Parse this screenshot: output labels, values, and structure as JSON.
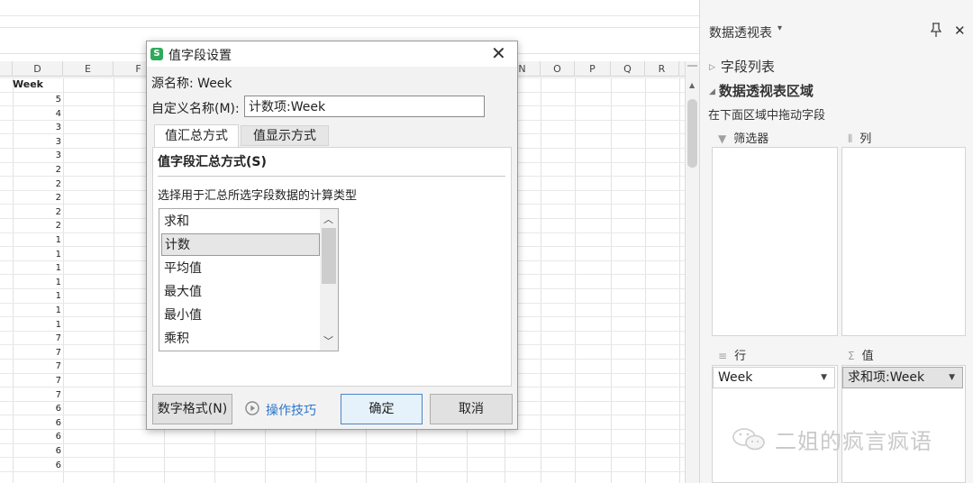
{
  "sheet": {
    "columns": [
      "D",
      "E",
      "F",
      "N",
      "O",
      "P",
      "Q",
      "R"
    ],
    "header_cell": "Week",
    "week_values": [
      "5",
      "4",
      "3",
      "3",
      "3",
      "2",
      "2",
      "2",
      "2",
      "2",
      "1",
      "1",
      "1",
      "1",
      "1",
      "1",
      "1",
      "7",
      "7",
      "7",
      "7",
      "7",
      "6",
      "6",
      "6",
      "6",
      "6"
    ]
  },
  "pane": {
    "title": "数据透视表",
    "field_list": "字段列表",
    "pivot_area": "数据透视表区域",
    "drag_hint": "在下面区域中拖动字段",
    "zones": {
      "filter": "筛选器",
      "columns": "列",
      "rows": "行",
      "values": "值"
    },
    "row_field": "Week",
    "value_field": "求和项:Week"
  },
  "watermark": "二姐的疯言疯语",
  "dialog": {
    "title": "值字段设置",
    "logo": "S",
    "source_label": "源名称:",
    "source_value": "Week",
    "custom_name_label": "自定义名称(M):",
    "custom_name_value": "计数项:Week",
    "tabs": [
      "值汇总方式",
      "值显示方式"
    ],
    "section_title": "值字段汇总方式(S)",
    "choose_text": "选择用于汇总所选字段数据的计算类型",
    "functions": [
      "求和",
      "计数",
      "平均值",
      "最大值",
      "最小值",
      "乘积"
    ],
    "selected_function": "计数",
    "buttons": {
      "number_format": "数字格式(N)",
      "tips": "操作技巧",
      "ok": "确定",
      "cancel": "取消"
    }
  }
}
